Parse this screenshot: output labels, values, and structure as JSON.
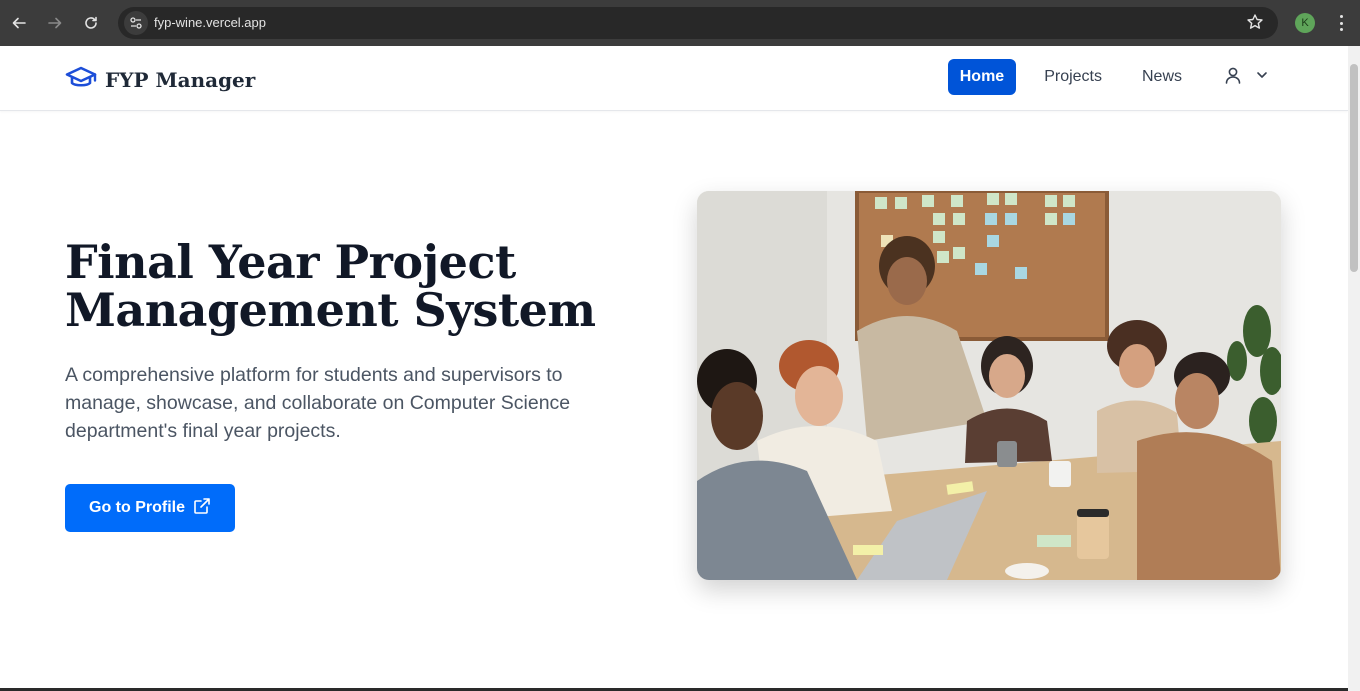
{
  "browser": {
    "url": "fyp-wine.vercel.app",
    "profile_initial": "K"
  },
  "header": {
    "brand": "FYP Manager",
    "nav": [
      {
        "label": "Home",
        "active": true
      },
      {
        "label": "Projects",
        "active": false
      },
      {
        "label": "News",
        "active": false
      }
    ]
  },
  "hero": {
    "title_line1": "Final Year Project",
    "title_line2": "Management System",
    "description": "A comprehensive platform for students and supervisors to manage, showcase, and collaborate on Computer Science department's final year projects.",
    "cta_label": "Go to Profile"
  },
  "colors": {
    "primary": "#006cfa",
    "nav_active": "#0054d8",
    "brand_icon": "#1d4ed8",
    "title": "#111827",
    "text_muted": "#4b5563"
  },
  "icons": {
    "brand": "graduation-cap-icon",
    "cta": "external-link-icon",
    "user": "user-icon",
    "user_menu_toggle": "chevron-down-icon"
  }
}
